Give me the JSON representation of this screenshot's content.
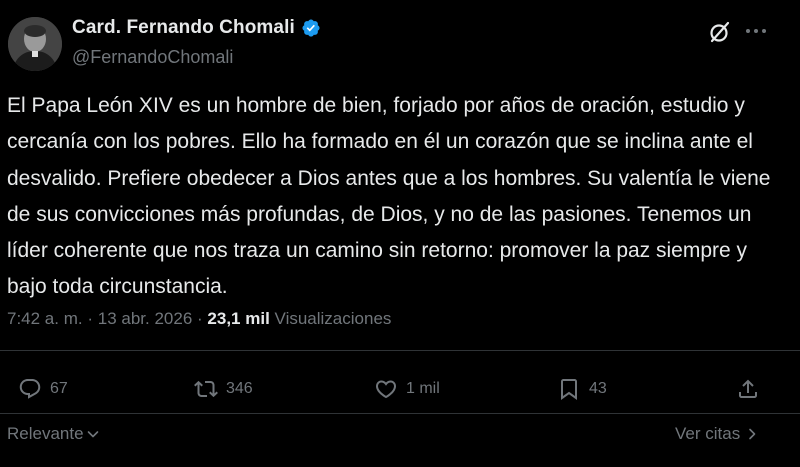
{
  "author": {
    "name": "Card. Fernando Chomali",
    "handle": "@FernandoChomali",
    "verified": true
  },
  "icons": {
    "verified": "verified-badge-icon",
    "grok": "grok-icon",
    "more": "more-options-icon",
    "reply": "reply-icon",
    "retweet": "retweet-icon",
    "like": "like-icon",
    "bookmark": "bookmark-icon",
    "share": "share-icon"
  },
  "colors": {
    "background": "#000000",
    "text": "#e7e9ea",
    "muted": "#71767b",
    "verified": "#1d9bf0",
    "divider": "#2f3336"
  },
  "tweet": {
    "text": "El Papa León XIV es un hombre de bien, forjado por años de oración, estudio y cercanía con los pobres. Ello ha formado en él un corazón que se inclina ante el desvalido. Prefiere obedecer a Dios antes que a los hombres. Su valentía le viene de sus convicciones más profundas, de Dios, y no de las pasiones. Tenemos un líder coherente que nos traza un camino sin retorno: promover la paz siempre y bajo toda circunstancia.",
    "time": "7:42 a. m.",
    "separator": "·",
    "date": "13 abr. 2026",
    "views_count": "23,1 mil",
    "views_label": "Visualizaciones"
  },
  "actions": {
    "replies": "67",
    "retweets": "346",
    "likes": "1 mil",
    "bookmarks": "43"
  },
  "footer": {
    "sort_label": "Relevante",
    "quotes_label": "Ver citas"
  }
}
